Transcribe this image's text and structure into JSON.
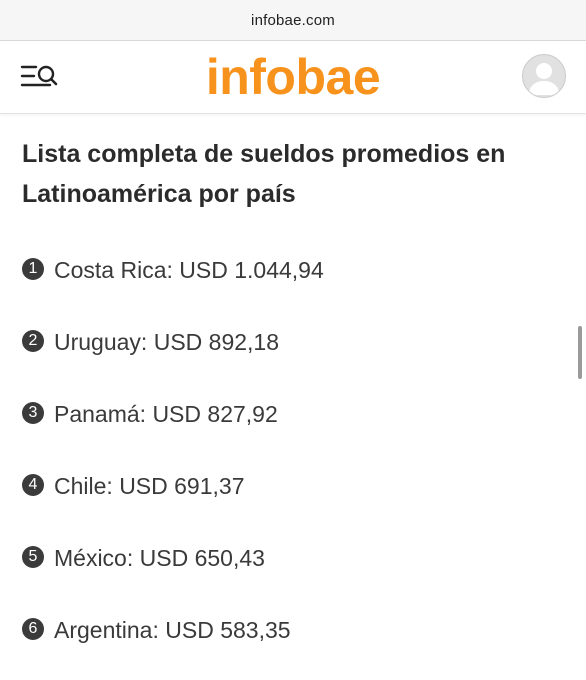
{
  "browser": {
    "url": "infobae.com"
  },
  "header": {
    "logo_text": "infobae",
    "logo_color": "#f7931d",
    "menu_icon": "menu-search-icon",
    "account_icon": "user-avatar-icon"
  },
  "article": {
    "headline": "Lista completa de sueldos promedios en Latinoamérica por país",
    "ranking": [
      {
        "number": "1",
        "text": "Costa Rica: USD 1.044,94"
      },
      {
        "number": "2",
        "text": "Uruguay: USD 892,18"
      },
      {
        "number": "3",
        "text": "Panamá: USD 827,92"
      },
      {
        "number": "4",
        "text": "Chile: USD 691,37"
      },
      {
        "number": "5",
        "text": "México: USD 650,43"
      },
      {
        "number": "6",
        "text": "Argentina: USD 583,35"
      }
    ]
  }
}
